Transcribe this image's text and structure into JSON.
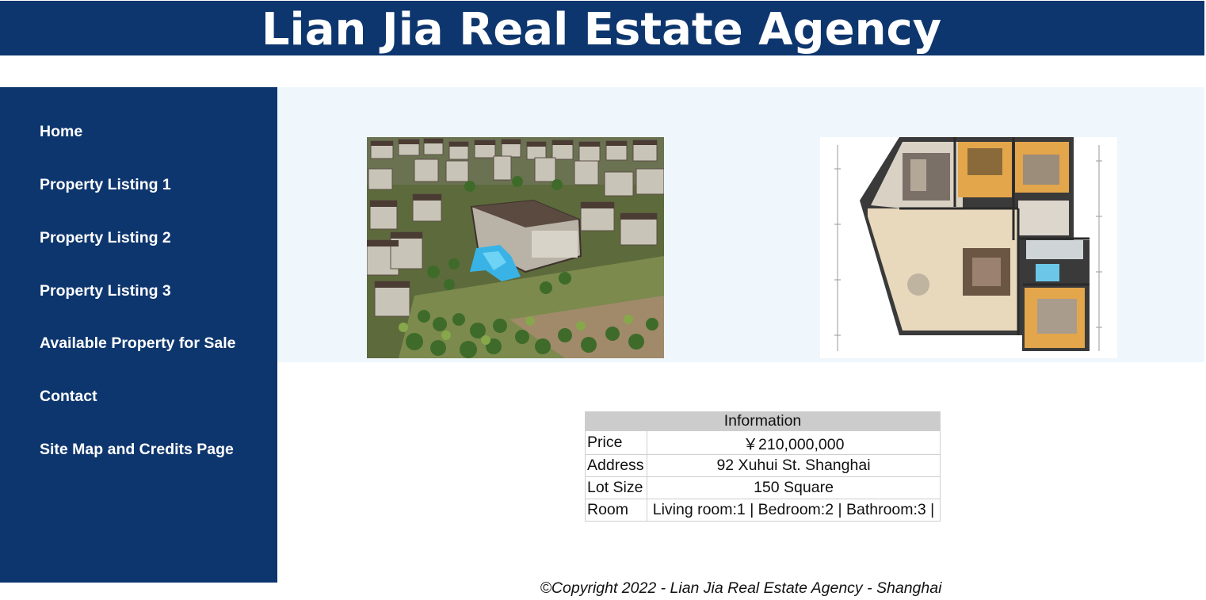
{
  "header": {
    "title": "Lian Jia Real Estate Agency"
  },
  "sidebar": {
    "items": [
      {
        "label": "Home"
      },
      {
        "label": "Property Listing 1"
      },
      {
        "label": "Property Listing 2"
      },
      {
        "label": "Property Listing 3"
      },
      {
        "label": "Available Property for Sale"
      },
      {
        "label": "Contact"
      },
      {
        "label": "Site Map and Credits Page"
      }
    ]
  },
  "images": {
    "aerial": "aerial-view-of-residential-complex",
    "floorplan": "apartment-floor-plan"
  },
  "info": {
    "heading": "Information",
    "rows": [
      {
        "label": "Price",
        "value": "￥210,000,000"
      },
      {
        "label": "Address",
        "value": "92 Xuhui St. Shanghai"
      },
      {
        "label": "Lot Size",
        "value": "150 Square"
      },
      {
        "label": "Room",
        "value": "Living room:1 | Bedroom:2 | Bathroom:3 |"
      }
    ]
  },
  "footer": {
    "text": "©Copyright 2022 - Lian Jia Real Estate Agency - Shanghai"
  },
  "colors": {
    "brand": "#0e366e",
    "band": "#eff7fd",
    "table_header": "#cccccc"
  }
}
